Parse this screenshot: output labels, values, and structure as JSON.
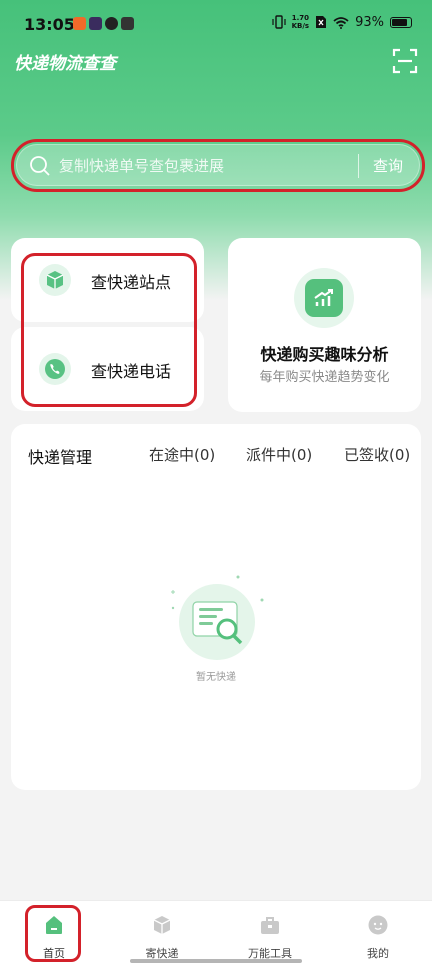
{
  "status_bar": {
    "time": "13:05",
    "net_speed_value": "1.70",
    "net_speed_unit": "KB/s",
    "battery": "93%"
  },
  "header": {
    "title": "快递物流查查"
  },
  "search": {
    "placeholder": "复制快递单号查包裹进展",
    "value": "",
    "button_label": "查询"
  },
  "quick_cards": [
    {
      "label": "查快递站点",
      "icon": "package-icon"
    },
    {
      "label": "查快递电话",
      "icon": "phone-icon"
    }
  ],
  "analysis_card": {
    "title": "快递购买趣味分析",
    "subtitle": "每年购买快递趋势变化",
    "icon": "trend-chart-icon"
  },
  "management": {
    "title": "快递管理",
    "tabs": [
      "在途中(0)",
      "派件中(0)",
      "已签收(0)"
    ],
    "empty_text": "暂无快递"
  },
  "bottom_nav": {
    "items": [
      {
        "label": "首页",
        "icon": "home-icon",
        "active": true
      },
      {
        "label": "寄快递",
        "icon": "send-package-icon",
        "active": false
      },
      {
        "label": "万能工具",
        "icon": "toolbox-icon",
        "active": false
      },
      {
        "label": "我的",
        "icon": "profile-icon",
        "active": false
      }
    ]
  },
  "colors": {
    "brand_green": "#46c17a",
    "highlight_red": "#d3212a"
  }
}
